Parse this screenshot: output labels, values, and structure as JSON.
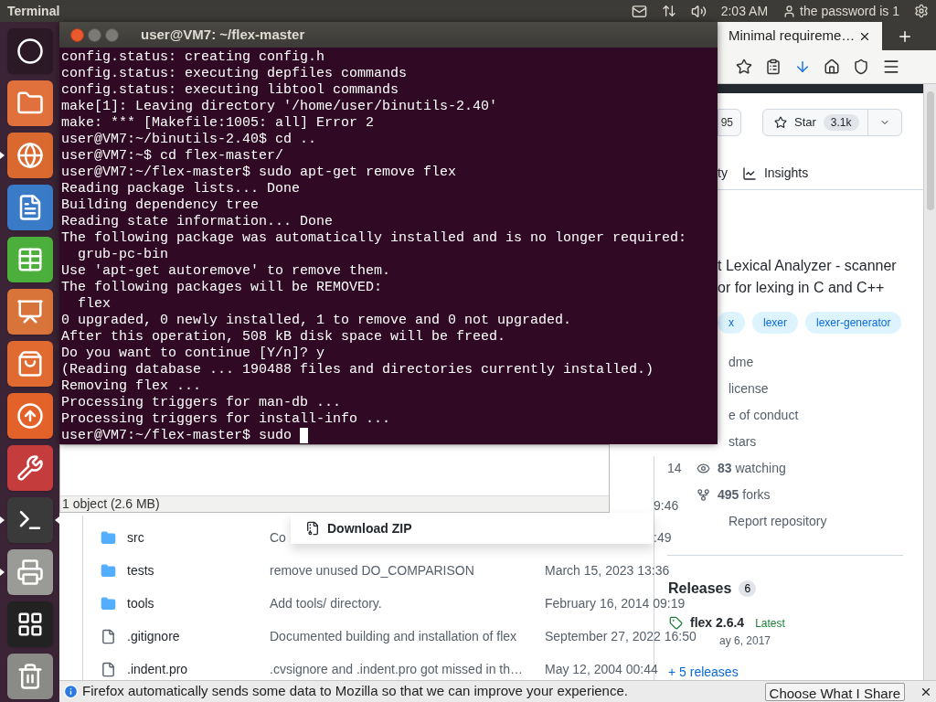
{
  "top_panel": {
    "app_title": "Terminal",
    "clock": "2:03 AM",
    "user": "the password is 1"
  },
  "launcher": [
    {
      "kind": "dash",
      "running": false,
      "focused": false
    },
    {
      "kind": "files",
      "running": false,
      "focused": false
    },
    {
      "kind": "browser",
      "running": true,
      "focused": false
    },
    {
      "kind": "writer",
      "running": false,
      "focused": false
    },
    {
      "kind": "calc",
      "running": false,
      "focused": false
    },
    {
      "kind": "impress",
      "running": false,
      "focused": false
    },
    {
      "kind": "store",
      "running": false,
      "focused": false
    },
    {
      "kind": "updater",
      "running": false,
      "focused": false
    },
    {
      "kind": "settings",
      "running": false,
      "focused": false
    },
    {
      "kind": "terminal",
      "running": true,
      "focused": true
    },
    {
      "kind": "printer",
      "running": true,
      "focused": false
    },
    {
      "kind": "workspaces",
      "running": false,
      "focused": false
    },
    {
      "kind": "trash",
      "running": false,
      "focused": false
    }
  ],
  "browser": {
    "tab_title": "Minimal requireme…",
    "fork_count": "95",
    "star_label": "Star",
    "star_count": "3.1k",
    "nav_fragment": "ty",
    "insights": "Insights",
    "description_lines": [
      "t Lexical Analyzer - scanner",
      "or for lexing in C and C++"
    ],
    "topics": [
      "x",
      "lexer",
      "lexer-generator"
    ],
    "links": [
      {
        "kind": "plain",
        "text": "dme"
      },
      {
        "kind": "plain",
        "text": "license"
      },
      {
        "kind": "plain",
        "text": "e of conduct"
      },
      {
        "kind": "plain",
        "text": "stars"
      },
      {
        "kind": "stat",
        "text": "**83** watching"
      },
      {
        "kind": "stat",
        "text": "**495** forks"
      },
      {
        "kind": "plain",
        "text": "Report repository"
      }
    ],
    "releases": {
      "title": "Releases",
      "count": "6",
      "name": "flex 2.6.4",
      "badge": "Latest",
      "date": "ay 6, 2017",
      "more": "+ 5 releases"
    },
    "files": [
      {
        "kind": "folder",
        "name": "src",
        "message": "Co",
        "date": ":49"
      },
      {
        "kind": "folder",
        "name": "tests",
        "message": "remove unused DO_COMPARISON",
        "date": "March 15, 2023 13:36"
      },
      {
        "kind": "folder",
        "name": "tools",
        "message": "Add tools/ directory.",
        "date": "February 16, 2014 09:19"
      },
      {
        "kind": "file",
        "name": ".gitignore",
        "message": "Documented building and installation of flex",
        "date": "September 27, 2022 16:50"
      },
      {
        "kind": "file",
        "name": ".indent.pro",
        "message": ".cvsignore and .indent.pro got missed in th…",
        "date": "May 12, 2004 00:44"
      }
    ],
    "download_item": "Download ZIP",
    "notification": {
      "message": "Firefox automatically sends some data to Mozilla so that we can improve your experience.",
      "button": "Choose What I Share"
    }
  },
  "file_manager": {
    "status": "1 object (2.6 MB)",
    "date_fragments": [
      "14",
      "9:46"
    ]
  },
  "terminal": {
    "title": "user@VM7: ~/flex-master",
    "lines": [
      "config.status: creating config.h",
      "config.status: executing depfiles commands",
      "config.status: executing libtool commands",
      "make[1]: Leaving directory '/home/user/binutils-2.40'",
      "make: *** [Makefile:1005: all] Error 2",
      "user@VM7:~/binutils-2.40$ cd ..",
      "user@VM7:~$ cd flex-master/",
      "user@VM7:~/flex-master$ sudo apt-get remove flex",
      "Reading package lists... Done",
      "Building dependency tree",
      "Reading state information... Done",
      "The following package was automatically installed and is no longer required:",
      "  grub-pc-bin",
      "Use 'apt-get autoremove' to remove them.",
      "The following packages will be REMOVED:",
      "  flex",
      "0 upgraded, 0 newly installed, 1 to remove and 0 not upgraded.",
      "After this operation, 508 kB disk space will be freed.",
      "Do you want to continue [Y/n]? y",
      "(Reading database ... 190488 files and directories currently installed.)",
      "Removing flex ...",
      "Processing triggers for man-db ...",
      "Processing triggers for install-info ..."
    ],
    "prompt": "user@VM7:~/flex-master$ sudo "
  }
}
